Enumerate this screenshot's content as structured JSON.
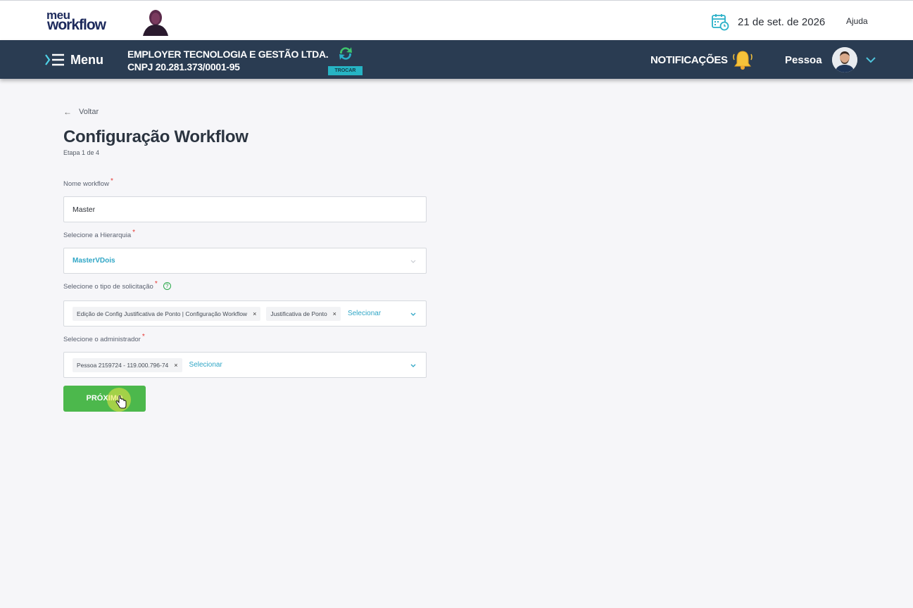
{
  "topbar": {
    "logo_top": "meu",
    "logo_bottom": "workflow",
    "date": "21 de set. de 2026",
    "help": "Ajuda"
  },
  "navbar": {
    "menu_label": "Menu",
    "company_name": "EMPLOYER TECNOLOGIA E GESTÃO LTDA.",
    "company_cnpj": "CNPJ 20.281.373/0001-95",
    "switch_label": "TROCAR",
    "notifications_label": "NOTIFICAÇÕES",
    "user_name": "Pessoa"
  },
  "page": {
    "back_label": "Voltar",
    "title": "Configuração Workflow",
    "step": "Etapa 1 de 4"
  },
  "form": {
    "name_label": "Nome workflow",
    "name_value": "Master",
    "hierarchy_label": "Selecione a Hierarquia",
    "hierarchy_value": "MasterVDois",
    "request_type_label": "Selecione o tipo de solicitação",
    "request_types": [
      "Edição de Config Justificativa de Ponto | Configuração Workflow",
      "Justificativa de Ponto"
    ],
    "select_placeholder": "Selecionar",
    "admin_label": "Selecione o administrador",
    "admins": [
      "Pessoa 2159724 - 119.000.796-74"
    ],
    "required_mark": "*",
    "chip_remove": "×",
    "next_button": "PRÓXIMO"
  },
  "colors": {
    "navbar": "#2a3c52",
    "accent": "#2fa6c6",
    "primary_button": "#4cb84c",
    "required": "#e53935"
  },
  "icons": [
    "calendar-clock-icon",
    "menu-icon",
    "refresh-icon",
    "bell-icon",
    "chevron-down-icon",
    "arrow-left-icon",
    "help-circle-icon",
    "hand-cursor-icon"
  ]
}
